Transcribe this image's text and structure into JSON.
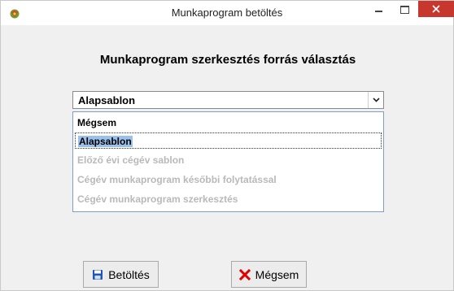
{
  "window": {
    "title": "Munkaprogram betöltés"
  },
  "heading": "Munkaprogram szerkesztés forrás választás",
  "combo": {
    "selected": "Alapsablon"
  },
  "dropdown": {
    "items": [
      {
        "label": "Mégsem",
        "state": "enabled"
      },
      {
        "label": "Alapsablon",
        "state": "selected"
      },
      {
        "label": "Előző évi cégév sablon",
        "state": "disabled"
      },
      {
        "label": "Cégév munkaprogram későbbi folytatással",
        "state": "disabled"
      },
      {
        "label": "Cégév munkaprogram szerkesztés",
        "state": "disabled"
      }
    ]
  },
  "buttons": {
    "load": {
      "label": "Betöltés",
      "icon": "floppy-disk-icon"
    },
    "cancel": {
      "label": "Mégsem",
      "icon": "red-x-icon"
    }
  },
  "colors": {
    "close_button": "#c7372e",
    "selection": "#99c1ec",
    "cancel_icon": "#e00000",
    "save_icon": "#1f55b5"
  }
}
